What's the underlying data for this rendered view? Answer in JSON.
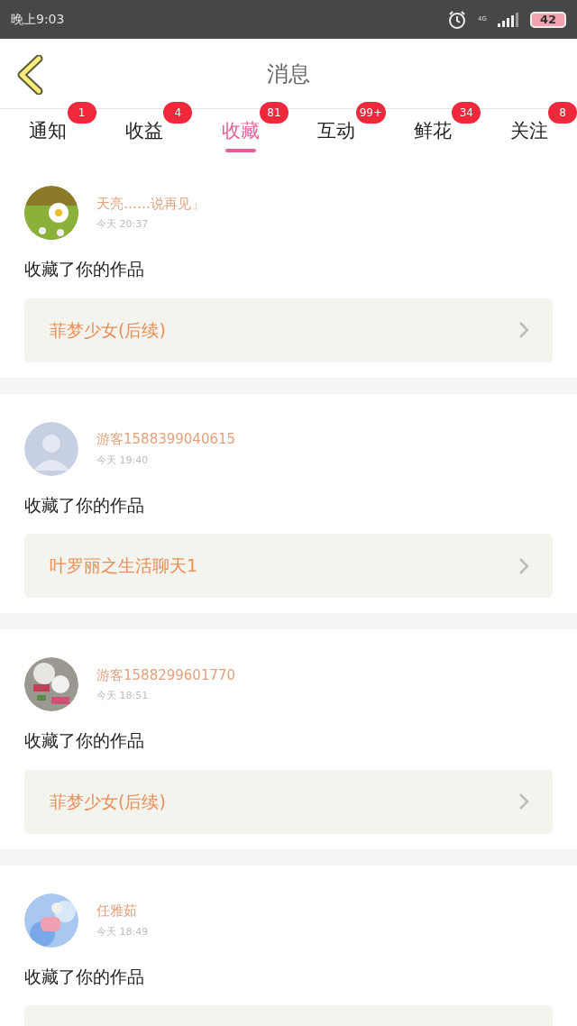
{
  "status_bar": {
    "time": "晚上9:03",
    "network": "4G",
    "battery": "42"
  },
  "header": {
    "title": "消息"
  },
  "tabs": [
    {
      "label": "通知",
      "badge": "1",
      "selected": false
    },
    {
      "label": "收益",
      "badge": "4",
      "selected": false
    },
    {
      "label": "收藏",
      "badge": "81",
      "selected": true
    },
    {
      "label": "互动",
      "badge": "99+",
      "selected": false
    },
    {
      "label": "鲜花",
      "badge": "34",
      "selected": false
    },
    {
      "label": "关注",
      "badge": "8",
      "selected": false
    }
  ],
  "messages": [
    {
      "user": "天亮……说再见」",
      "time": "今天 20:37",
      "action": "收藏了你的作品",
      "work": "菲梦少女(后续)"
    },
    {
      "avatar": {
        "kind": "default"
      },
      "user": "游客1588399040615",
      "time": "今天 19:40",
      "action": "收藏了你的作品",
      "work": "叶罗丽之生活聊天1"
    },
    {
      "user": "游客1588299601770",
      "time": "今天 18:51",
      "action": "收藏了你的作品",
      "work": "菲梦少女(后续)"
    },
    {
      "user": "任雅茹",
      "time": "今天 18:49",
      "action": "收藏了你的作品",
      "work_cut": true
    }
  ]
}
